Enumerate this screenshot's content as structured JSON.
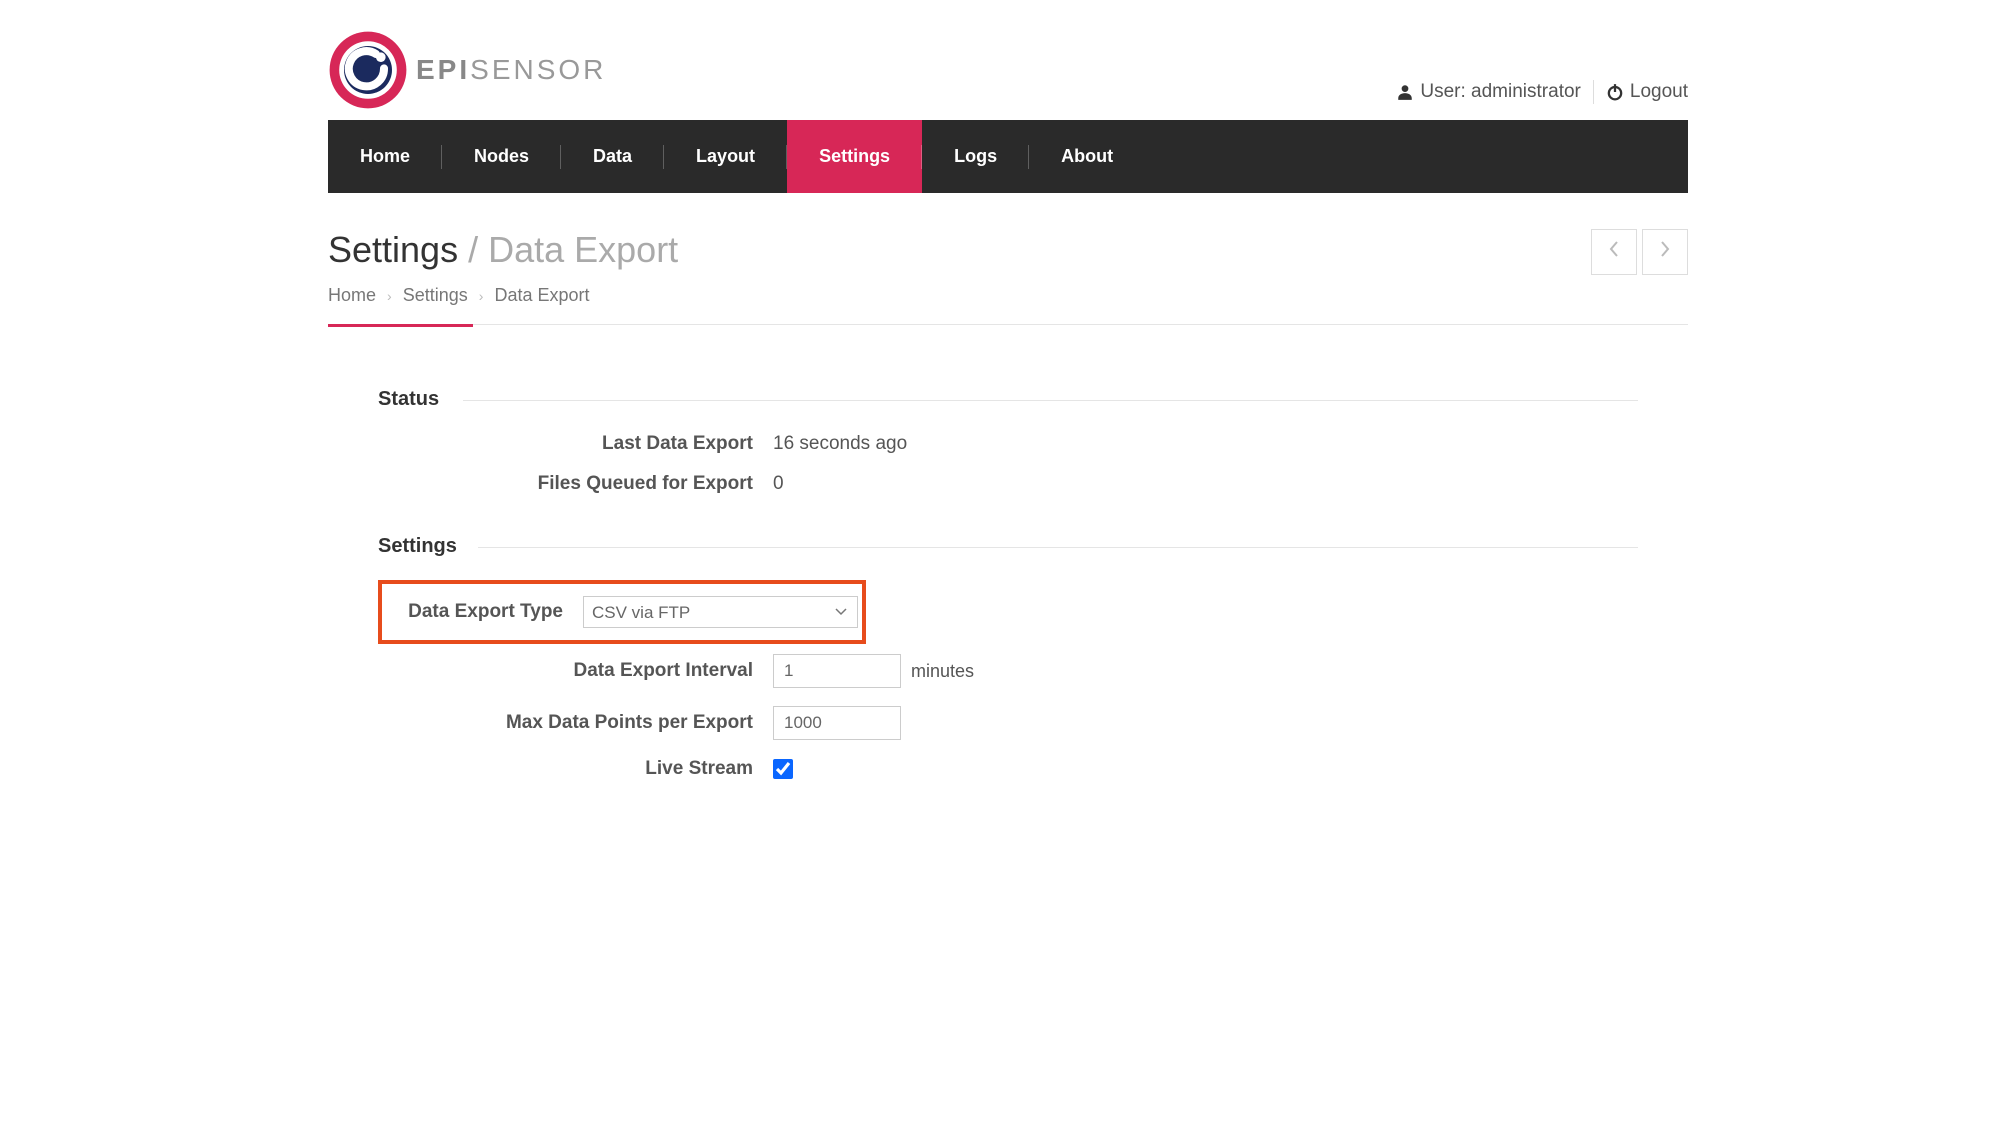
{
  "header": {
    "logo_bold": "EPI",
    "logo_light": "SENSOR",
    "user_label": "User:",
    "user_name": "administrator",
    "logout_label": "Logout"
  },
  "nav": {
    "items": [
      "Home",
      "Nodes",
      "Data",
      "Layout",
      "Settings",
      "Logs",
      "About"
    ],
    "active_index": 4
  },
  "page": {
    "title_main": "Settings",
    "title_sub": "/ Data Export",
    "breadcrumbs": [
      "Home",
      "Settings",
      "Data Export"
    ]
  },
  "sections": {
    "status_title": "Status",
    "settings_title": "Settings"
  },
  "status": {
    "last_export_label": "Last Data Export",
    "last_export_value": "16 seconds ago",
    "files_queued_label": "Files Queued for Export",
    "files_queued_value": "0"
  },
  "settings": {
    "export_type_label": "Data Export Type",
    "export_type_value": "CSV via FTP",
    "export_interval_label": "Data Export Interval",
    "export_interval_value": "1",
    "export_interval_unit": "minutes",
    "max_points_label": "Max Data Points per Export",
    "max_points_value": "1000",
    "live_stream_label": "Live Stream",
    "live_stream_checked": true
  }
}
